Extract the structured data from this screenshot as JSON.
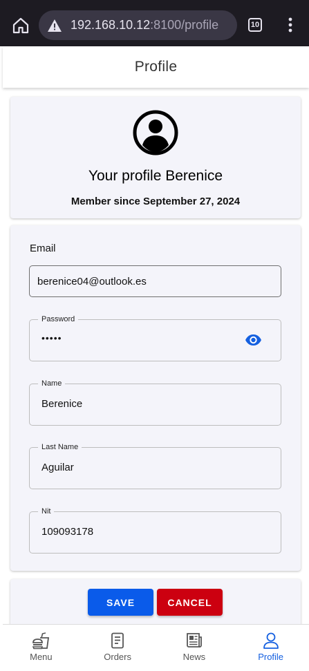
{
  "browser": {
    "url_host": "192.168.10.12",
    "url_path": ":8100/profile",
    "tab_count": "10"
  },
  "header": {
    "title": "Profile"
  },
  "profile": {
    "title": "Your profile Berenice",
    "member_since": "Member since September 27, 2024"
  },
  "form": {
    "email_label": "Email",
    "email_value": "berenice04@outlook.es",
    "password_label": "Password",
    "password_value": "•••••",
    "name_label": "Name",
    "name_value": "Berenice",
    "last_name_label": "Last Name",
    "last_name_value": "Aguilar",
    "nit_label": "Nit",
    "nit_value": "109093178"
  },
  "actions": {
    "save_label": "SAVE",
    "cancel_label": "CANCEL"
  },
  "nav": {
    "items": [
      {
        "label": "Menu",
        "icon": "fastfood-icon",
        "active": false
      },
      {
        "label": "Orders",
        "icon": "receipt-icon",
        "active": false
      },
      {
        "label": "News",
        "icon": "newspaper-icon",
        "active": false
      },
      {
        "label": "Profile",
        "icon": "person-icon",
        "active": true
      }
    ]
  },
  "colors": {
    "accent": "#1560e0",
    "save": "#0a5bea",
    "cancel": "#cc0010",
    "card_bg": "#f4f4fa",
    "browser_bar": "#1d1b22"
  }
}
